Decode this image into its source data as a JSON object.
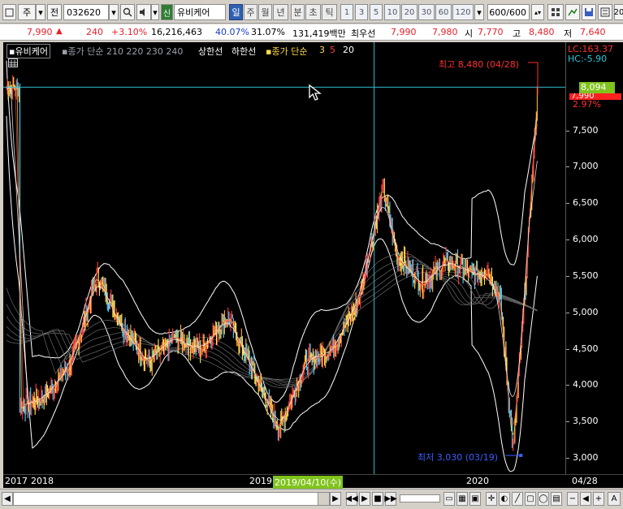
{
  "toolbar": {
    "market": "주",
    "mode": "전",
    "code": "032620",
    "badge": "신",
    "name": "유비케어",
    "periods": [
      "일",
      "주",
      "월",
      "년",
      "분",
      "초",
      "틱"
    ],
    "active_period": "일",
    "minute_steps": [
      "1",
      "3",
      "5",
      "10",
      "20",
      "30",
      "60",
      "120"
    ],
    "count": "600/600",
    "right_edge": "20"
  },
  "pricebar": {
    "price": "7,990",
    "arrow": "▲",
    "change": "240",
    "change_pct": "+3.10%",
    "volume": "16,216,463",
    "turnover": "40.07%",
    "ratio": "31.07%",
    "amount": "131,419백만",
    "bid_label": "최우선",
    "bid": "7,990",
    "ask": "7,980",
    "open_label": "시",
    "open": "7,770",
    "high_label": "고",
    "high": "8,480",
    "low_label": "저",
    "low": "7,640"
  },
  "legend": {
    "name": "유비케어",
    "ma_text": "종가 단순 210 220 230 240",
    "upper": "상한선",
    "lower": "하한선",
    "short_label": "종가 단순",
    "short_periods": [
      "3",
      "5",
      "20"
    ]
  },
  "annotations": {
    "high": "최고 8,480 (04/28)",
    "low": "최저 3,030 (03/19)",
    "lc": "LC:163.37",
    "hc": "HC:-5.90",
    "cursor_price": "8,094",
    "last_price": "7,990",
    "last_pct": "2.97%"
  },
  "axis": {
    "y_ticks": [
      "7,500",
      "7,000",
      "6,500",
      "6,000",
      "5,500",
      "5,000",
      "4,500",
      "4,000",
      "3,500",
      "3,000"
    ],
    "x_labels": [
      "2017",
      "2018",
      "2019",
      "2020"
    ],
    "cursor_date": "2019/04/10(수)",
    "last_date": "04/28"
  },
  "colors": {
    "chart_bg": "#000000",
    "up": "#ff3030",
    "down": "#ffff40",
    "ma_band": "#ffffff",
    "crosshair": "#33bbcc",
    "high_ann": "#ff3030",
    "low_ann": "#3b5cff",
    "cursor_box": "#7fc31c"
  },
  "chart_data": {
    "type": "line",
    "title": "",
    "series": [
      {
        "name": "유비케어",
        "points": [
          [
            "2017-01",
            3700
          ],
          [
            "2017-03",
            3850
          ],
          [
            "2017-05",
            4300
          ],
          [
            "2017-07",
            5500
          ],
          [
            "2017-09",
            4800
          ],
          [
            "2017-11",
            4300
          ],
          [
            "2018-01",
            4650
          ],
          [
            "2018-03",
            4500
          ],
          [
            "2018-05",
            4950
          ],
          [
            "2018-07",
            4200
          ],
          [
            "2018-09",
            3400
          ],
          [
            "2018-11",
            4300
          ],
          [
            "2019-01",
            4500
          ],
          [
            "2019-03",
            5100
          ],
          [
            "2019-05",
            6700
          ],
          [
            "2019-06",
            5800
          ],
          [
            "2019-08",
            5400
          ],
          [
            "2019-10",
            5700
          ],
          [
            "2019-12",
            5500
          ],
          [
            "2020-01",
            5600
          ],
          [
            "2020-02",
            5200
          ],
          [
            "2020-03",
            3100
          ],
          [
            "2020-04",
            5500
          ],
          [
            "2020-04-28",
            8094
          ]
        ]
      }
    ],
    "ylim": [
      2800,
      8600
    ]
  }
}
